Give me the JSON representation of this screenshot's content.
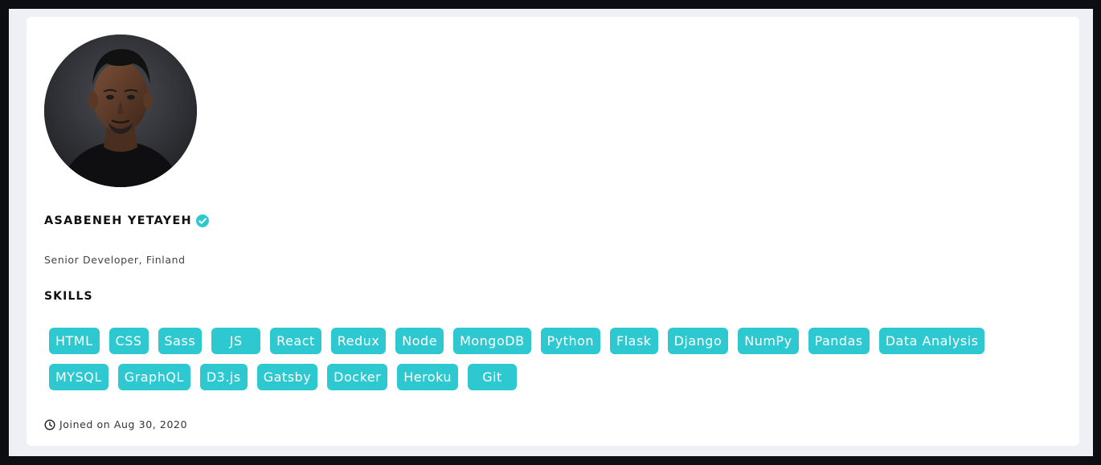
{
  "profile": {
    "name": "ASABENEH YETAYEH",
    "title": "Senior Developer, Finland",
    "verified_icon": "verified-check-icon",
    "avatar_icon": "profile-photo"
  },
  "skills_section": {
    "title": "SKILLS",
    "rows": [
      [
        "HTML",
        "CSS",
        "Sass",
        "JS",
        "React",
        "Redux",
        "Node",
        "MongoDB",
        "Python",
        "Flask",
        "Django",
        "NumPy",
        "Pandas",
        "Data Analysis"
      ],
      [
        "MYSQL",
        "GraphQL",
        "D3.js",
        "Gatsby",
        "Docker",
        "Heroku",
        "Git"
      ]
    ]
  },
  "meta": {
    "joined_text": "Joined on Aug 30, 2020",
    "joined_icon": "clock-icon"
  },
  "colors": {
    "accent": "#2ec9d0",
    "card_bg": "#ffffff",
    "page_bg": "#eef0f5",
    "outer_bg": "#0c0e12"
  }
}
